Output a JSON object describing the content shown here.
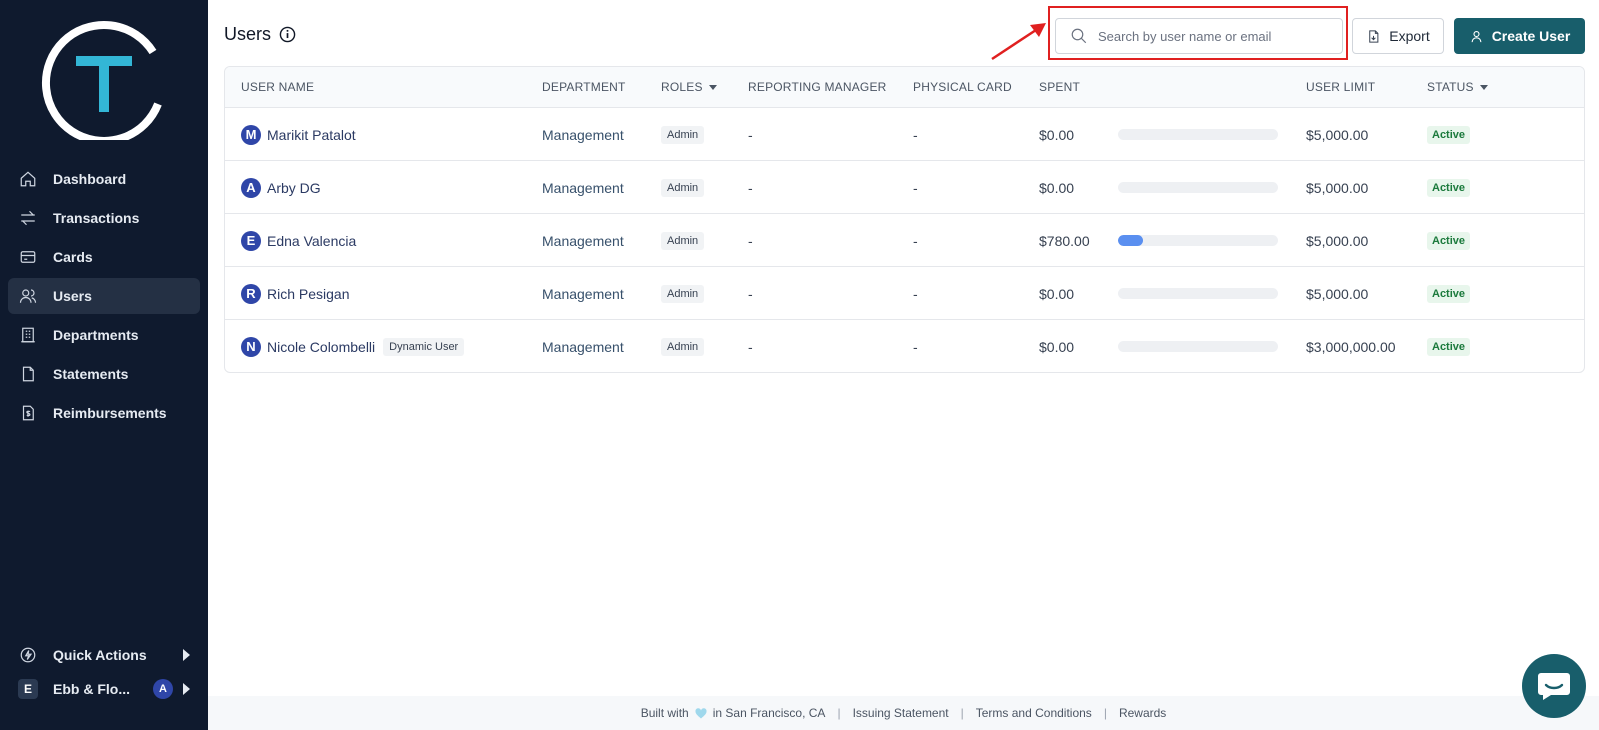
{
  "sidebar": {
    "logo_letter": "T",
    "items": [
      {
        "label": "Dashboard",
        "icon": "home-icon"
      },
      {
        "label": "Transactions",
        "icon": "transfer-icon"
      },
      {
        "label": "Cards",
        "icon": "card-icon"
      },
      {
        "label": "Users",
        "icon": "users-icon",
        "active": true
      },
      {
        "label": "Departments",
        "icon": "building-icon"
      },
      {
        "label": "Statements",
        "icon": "document-icon"
      },
      {
        "label": "Reimbursements",
        "icon": "receipt-icon"
      }
    ],
    "quick_actions": "Quick Actions",
    "org": {
      "badge": "E",
      "name": "Ebb & Flo...",
      "user_initial": "A"
    }
  },
  "header": {
    "title": "Users",
    "search_placeholder": "Search by user name or email",
    "export_label": "Export",
    "create_label": "Create User"
  },
  "table": {
    "columns": [
      "USER NAME",
      "DEPARTMENT",
      "ROLES",
      "REPORTING MANAGER",
      "PHYSICAL CARD",
      "SPENT",
      "USER LIMIT",
      "STATUS"
    ],
    "rows": [
      {
        "initial": "M",
        "name": "Marikit Patalot",
        "tag": "",
        "department": "Management",
        "role": "Admin",
        "manager": "-",
        "card": "-",
        "spent": "$0.00",
        "progress": 0,
        "limit": "$5,000.00",
        "status": "Active"
      },
      {
        "initial": "A",
        "name": "Arby DG",
        "tag": "",
        "department": "Management",
        "role": "Admin",
        "manager": "-",
        "card": "-",
        "spent": "$0.00",
        "progress": 0,
        "limit": "$5,000.00",
        "status": "Active"
      },
      {
        "initial": "E",
        "name": "Edna Valencia",
        "tag": "",
        "department": "Management",
        "role": "Admin",
        "manager": "-",
        "card": "-",
        "spent": "$780.00",
        "progress": 0.156,
        "limit": "$5,000.00",
        "status": "Active"
      },
      {
        "initial": "R",
        "name": "Rich Pesigan",
        "tag": "",
        "department": "Management",
        "role": "Admin",
        "manager": "-",
        "card": "-",
        "spent": "$0.00",
        "progress": 0,
        "limit": "$5,000.00",
        "status": "Active"
      },
      {
        "initial": "N",
        "name": "Nicole Colombelli",
        "tag": "Dynamic User",
        "department": "Management",
        "role": "Admin",
        "manager": "-",
        "card": "-",
        "spent": "$0.00",
        "progress": 0,
        "limit": "$3,000,000.00",
        "status": "Active"
      }
    ]
  },
  "footer": {
    "built_prefix": "Built with",
    "built_suffix": "in San Francisco, CA",
    "links": [
      "Issuing Statement",
      "Terms and Conditions",
      "Rewards"
    ]
  },
  "colors": {
    "sidebar_bg": "#0f1a2e",
    "accent": "#185e6b",
    "avatar": "#2f46a8",
    "progress": "#5a8ff0",
    "highlight": "#e02020"
  }
}
